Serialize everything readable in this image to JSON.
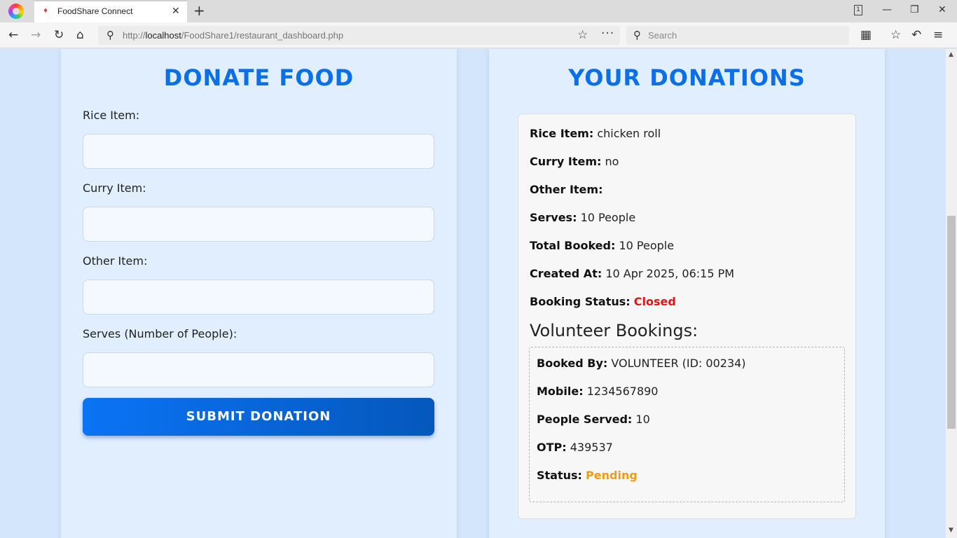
{
  "browser": {
    "tab_title": "FoodShare Connect",
    "tab_count": "1",
    "url_prefix": "http://",
    "url_host": "localhost",
    "url_path": "/FoodShare1/restaurant_dashboard.php",
    "search_placeholder": "Search"
  },
  "donate_form": {
    "heading": "DONATE FOOD",
    "fields": [
      {
        "label": "Rice Item:",
        "value": ""
      },
      {
        "label": "Curry Item:",
        "value": ""
      },
      {
        "label": "Other Item:",
        "value": ""
      },
      {
        "label": "Serves (Number of People):",
        "value": ""
      }
    ],
    "submit_label": "SUBMIT DONATION"
  },
  "donations": {
    "heading": "YOUR DONATIONS",
    "items": [
      {
        "rice_label": "Rice Item:",
        "rice_value": "chicken roll",
        "curry_label": "Curry Item:",
        "curry_value": "no",
        "other_label": "Other Item:",
        "other_value": "",
        "serves_label": "Serves:",
        "serves_value": "10 People",
        "booked_label": "Total Booked:",
        "booked_value": "10 People",
        "created_label": "Created At:",
        "created_value": "10 Apr 2025, 06:15 PM",
        "status_label": "Booking Status:",
        "status_value": "Closed",
        "bookings_heading": "Volunteer Bookings:",
        "bookings": [
          {
            "by_label": "Booked By:",
            "by_value": "VOLUNTEER (ID: 00234)",
            "mobile_label": "Mobile:",
            "mobile_value": "1234567890",
            "people_label": "People Served:",
            "people_value": "10",
            "otp_label": "OTP:",
            "otp_value": "439537",
            "status_label": "Status:",
            "status_value": "Pending"
          }
        ]
      }
    ]
  },
  "colors": {
    "heading": "#0b6fe8",
    "status_closed": "#e41313",
    "status_pending": "#f39c12"
  }
}
